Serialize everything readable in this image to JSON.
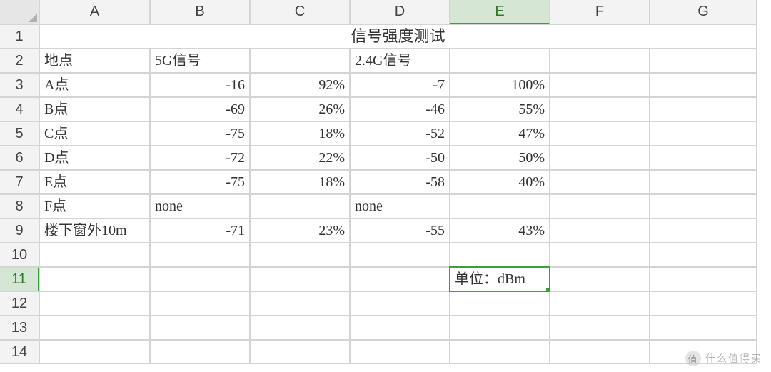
{
  "columns": [
    "A",
    "B",
    "C",
    "D",
    "E",
    "F",
    "G"
  ],
  "row_count": 14,
  "active_cell": {
    "row": 11,
    "col": "E"
  },
  "title": "信号强度测试",
  "headers": {
    "A": "地点",
    "B": "5G信号",
    "D": "2.4G信号"
  },
  "unit_label": "单位：dBm",
  "rows": [
    {
      "loc": "A点",
      "sig5": "-16",
      "pct5": "92%",
      "sig24": "-7",
      "pct24": "100%"
    },
    {
      "loc": "B点",
      "sig5": "-69",
      "pct5": "26%",
      "sig24": "-46",
      "pct24": "55%"
    },
    {
      "loc": "C点",
      "sig5": "-75",
      "pct5": "18%",
      "sig24": "-52",
      "pct24": "47%"
    },
    {
      "loc": "D点",
      "sig5": "-72",
      "pct5": "22%",
      "sig24": "-50",
      "pct24": "50%"
    },
    {
      "loc": "E点",
      "sig5": "-75",
      "pct5": "18%",
      "sig24": "-58",
      "pct24": "40%"
    },
    {
      "loc": "F点",
      "sig5": "none",
      "pct5": "",
      "sig24": "none",
      "pct24": ""
    },
    {
      "loc": "楼下窗外10m",
      "sig5": "-71",
      "pct5": "23%",
      "sig24": "-55",
      "pct24": "43%"
    }
  ],
  "chart_data": {
    "type": "table",
    "title": "信号强度测试",
    "unit": "dBm",
    "columns": [
      "地点",
      "5G信号(dBm)",
      "5G(%)",
      "2.4G信号(dBm)",
      "2.4G(%)"
    ],
    "series": [
      {
        "地点": "A点",
        "5G_dBm": -16,
        "5G_pct": 92,
        "2.4G_dBm": -7,
        "2.4G_pct": 100
      },
      {
        "地点": "B点",
        "5G_dBm": -69,
        "5G_pct": 26,
        "2.4G_dBm": -46,
        "2.4G_pct": 55
      },
      {
        "地点": "C点",
        "5G_dBm": -75,
        "5G_pct": 18,
        "2.4G_dBm": -52,
        "2.4G_pct": 47
      },
      {
        "地点": "D点",
        "5G_dBm": -72,
        "5G_pct": 22,
        "2.4G_dBm": -50,
        "2.4G_pct": 50
      },
      {
        "地点": "E点",
        "5G_dBm": -75,
        "5G_pct": 18,
        "2.4G_dBm": -58,
        "2.4G_pct": 40
      },
      {
        "地点": "F点",
        "5G_dBm": null,
        "5G_pct": null,
        "2.4G_dBm": null,
        "2.4G_pct": null
      },
      {
        "地点": "楼下窗外10m",
        "5G_dBm": -71,
        "5G_pct": 23,
        "2.4G_dBm": -55,
        "2.4G_pct": 43
      }
    ]
  },
  "watermark": "什么值得买"
}
